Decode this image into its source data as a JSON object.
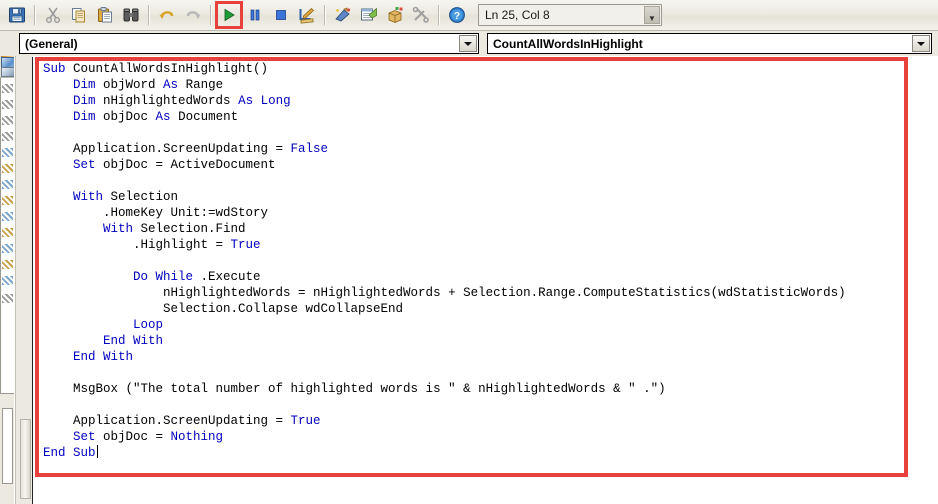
{
  "window": {
    "app": "Microsoft Visual Basic for Applications - Code Editor"
  },
  "toolbar": {
    "items": [
      {
        "name": "save-button",
        "icon": "save-floppy-icon",
        "tooltip": "Save",
        "enabled": true
      },
      {
        "name": "cut-button",
        "icon": "scissors-icon",
        "tooltip": "Cut",
        "enabled": false
      },
      {
        "name": "copy-button",
        "icon": "copy-icon",
        "tooltip": "Copy",
        "enabled": true
      },
      {
        "name": "paste-button",
        "icon": "clipboard-paste-icon",
        "tooltip": "Paste",
        "enabled": true
      },
      {
        "name": "find-button",
        "icon": "binoculars-icon",
        "tooltip": "Find",
        "enabled": true
      },
      {
        "name": "undo-button",
        "icon": "undo-arrow-icon",
        "tooltip": "Undo",
        "enabled": true
      },
      {
        "name": "redo-button",
        "icon": "redo-arrow-icon",
        "tooltip": "Redo",
        "enabled": false
      },
      {
        "name": "run-button",
        "icon": "play-triangle-icon",
        "tooltip": "Run Sub/UserForm",
        "enabled": true,
        "highlighted": true
      },
      {
        "name": "break-button",
        "icon": "pause-bars-icon",
        "tooltip": "Break",
        "enabled": true
      },
      {
        "name": "reset-button",
        "icon": "stop-square-icon",
        "tooltip": "Reset",
        "enabled": true
      },
      {
        "name": "design-mode-button",
        "icon": "ruler-pencil-icon",
        "tooltip": "Design Mode",
        "enabled": true
      },
      {
        "name": "project-explorer-button",
        "icon": "project-explorer-icon",
        "tooltip": "Project Explorer",
        "enabled": true
      },
      {
        "name": "properties-window-button",
        "icon": "properties-window-icon",
        "tooltip": "Properties Window",
        "enabled": true
      },
      {
        "name": "object-browser-button",
        "icon": "object-browser-icon",
        "tooltip": "Object Browser",
        "enabled": true
      },
      {
        "name": "toolbox-button",
        "icon": "hammer-wrench-icon",
        "tooltip": "Toolbox",
        "enabled": false
      },
      {
        "name": "help-button",
        "icon": "help-question-icon",
        "tooltip": "Microsoft Visual Basic Help",
        "enabled": true
      }
    ],
    "position_field": {
      "value": "Ln 25, Col 8",
      "placeholder": ""
    },
    "run_highlight_color": "#e8413c"
  },
  "code_window": {
    "module_combo": {
      "value": "(General)",
      "options": [
        "(General)"
      ]
    },
    "procedure_combo": {
      "value": "CountAllWordsInHighlight",
      "options": [
        "CountAllWordsInHighlight"
      ]
    },
    "keyword_color": "#0000C0",
    "text_color": "#000000",
    "background": "#FFFFFF",
    "lines": [
      [
        {
          "t": "Sub ",
          "k": true
        },
        {
          "t": "CountAllWordsInHighlight()",
          "k": false
        }
      ],
      [
        {
          "t": "    ",
          "k": false
        },
        {
          "t": "Dim ",
          "k": true
        },
        {
          "t": "objWord ",
          "k": false
        },
        {
          "t": "As ",
          "k": true
        },
        {
          "t": "Range",
          "k": false
        }
      ],
      [
        {
          "t": "    ",
          "k": false
        },
        {
          "t": "Dim ",
          "k": true
        },
        {
          "t": "nHighlightedWords ",
          "k": false
        },
        {
          "t": "As ",
          "k": true
        },
        {
          "t": "Long",
          "k": true
        }
      ],
      [
        {
          "t": "    ",
          "k": false
        },
        {
          "t": "Dim ",
          "k": true
        },
        {
          "t": "objDoc ",
          "k": false
        },
        {
          "t": "As ",
          "k": true
        },
        {
          "t": "Document",
          "k": false
        }
      ],
      [
        {
          "t": "",
          "k": false
        }
      ],
      [
        {
          "t": "    Application.ScreenUpdating = ",
          "k": false
        },
        {
          "t": "False",
          "k": true
        }
      ],
      [
        {
          "t": "    ",
          "k": false
        },
        {
          "t": "Set ",
          "k": true
        },
        {
          "t": "objDoc = ActiveDocument",
          "k": false
        }
      ],
      [
        {
          "t": "",
          "k": false
        }
      ],
      [
        {
          "t": "    ",
          "k": false
        },
        {
          "t": "With ",
          "k": true
        },
        {
          "t": "Selection",
          "k": false
        }
      ],
      [
        {
          "t": "        .HomeKey Unit:=wdStory",
          "k": false
        }
      ],
      [
        {
          "t": "        ",
          "k": false
        },
        {
          "t": "With ",
          "k": true
        },
        {
          "t": "Selection.Find",
          "k": false
        }
      ],
      [
        {
          "t": "            .Highlight = ",
          "k": false
        },
        {
          "t": "True",
          "k": true
        }
      ],
      [
        {
          "t": "",
          "k": false
        }
      ],
      [
        {
          "t": "            ",
          "k": false
        },
        {
          "t": "Do While ",
          "k": true
        },
        {
          "t": ".Execute",
          "k": false
        }
      ],
      [
        {
          "t": "                nHighlightedWords = nHighlightedWords + Selection.Range.ComputeStatistics(wdStatisticWords)",
          "k": false
        }
      ],
      [
        {
          "t": "                Selection.Collapse wdCollapseEnd",
          "k": false
        }
      ],
      [
        {
          "t": "            ",
          "k": false
        },
        {
          "t": "Loop",
          "k": true
        }
      ],
      [
        {
          "t": "        ",
          "k": false
        },
        {
          "t": "End With",
          "k": true
        }
      ],
      [
        {
          "t": "    ",
          "k": false
        },
        {
          "t": "End With",
          "k": true
        }
      ],
      [
        {
          "t": "",
          "k": false
        }
      ],
      [
        {
          "t": "    MsgBox (\"The total number of highlighted words is \" & nHighlightedWords & \" .\")",
          "k": false
        }
      ],
      [
        {
          "t": "",
          "k": false
        }
      ],
      [
        {
          "t": "    Application.ScreenUpdating = ",
          "k": false
        },
        {
          "t": "True",
          "k": true
        }
      ],
      [
        {
          "t": "    ",
          "k": false
        },
        {
          "t": "Set ",
          "k": true
        },
        {
          "t": "objDoc = ",
          "k": false
        },
        {
          "t": "Nothing",
          "k": true
        }
      ],
      [
        {
          "t": "",
          "k": true
        },
        {
          "t": "End Sub",
          "k": true
        },
        {
          "t": "__CARET__",
          "k": false
        }
      ]
    ]
  },
  "annotation": {
    "code_box_color": "#e8413c",
    "run_box_color": "#e8413c"
  }
}
